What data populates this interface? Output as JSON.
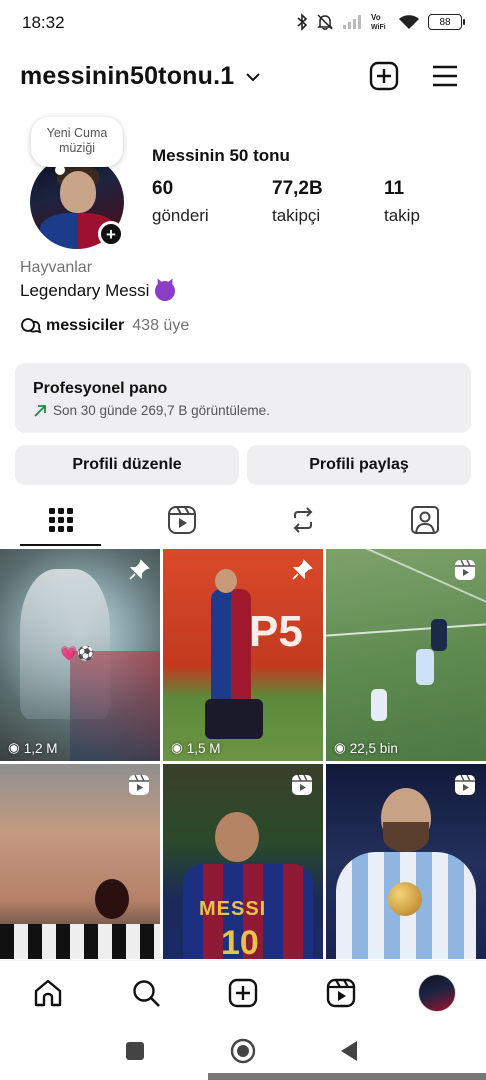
{
  "status_bar": {
    "time": "18:32",
    "battery": "88",
    "icons": [
      "bluetooth-icon",
      "mute-icon",
      "signal-icon",
      "vowifi-icon",
      "wifi-icon",
      "battery-icon"
    ],
    "vowifi": "Vo\nWiFi"
  },
  "header": {
    "username": "messinin50tonu.1",
    "icons": [
      "chevron-down-icon",
      "new-post-icon",
      "menu-icon"
    ]
  },
  "profile": {
    "note": "Yeni Cuma müziği",
    "display_name": "Messinin 50 tonu",
    "stats": [
      {
        "value": "60",
        "label": "gönderi"
      },
      {
        "value": "77,2B",
        "label": "takipçi"
      },
      {
        "value": "11",
        "label": "takip"
      }
    ],
    "category": "Hayvanlar",
    "bio": "Legendary Messi",
    "bio_emoji": "devil-face-emoji",
    "channel": {
      "name": "messiciler",
      "members": "438 üye"
    }
  },
  "pro_dashboard": {
    "title": "Profesyonel pano",
    "subtitle": "Son 30 günde 269,7 B görüntüleme."
  },
  "buttons": {
    "edit": "Profili düzenle",
    "share": "Profili paylaş"
  },
  "tabs": [
    {
      "icon": "grid-icon",
      "selected": true
    },
    {
      "icon": "reels-icon",
      "selected": false
    },
    {
      "icon": "reposts-icon",
      "selected": false
    },
    {
      "icon": "tagged-icon",
      "selected": false
    }
  ],
  "posts": [
    {
      "views": "1,2 M",
      "badge": "pin-icon",
      "emoji": "💗⚽"
    },
    {
      "views": "1,5 M",
      "badge": "pin-icon"
    },
    {
      "views": "22,5 bin",
      "badge": "reels-icon"
    },
    {
      "views": "",
      "badge": "reels-icon"
    },
    {
      "views": "",
      "badge": "reels-icon",
      "jersey_name": "MESSI",
      "jersey_number": "10"
    },
    {
      "views": "",
      "badge": "reels-icon"
    }
  ],
  "bottom_nav": [
    "home-icon",
    "search-icon",
    "create-icon",
    "reels-icon",
    "profile-avatar"
  ],
  "android_nav": [
    "recents-icon",
    "home-icon",
    "back-icon"
  ]
}
